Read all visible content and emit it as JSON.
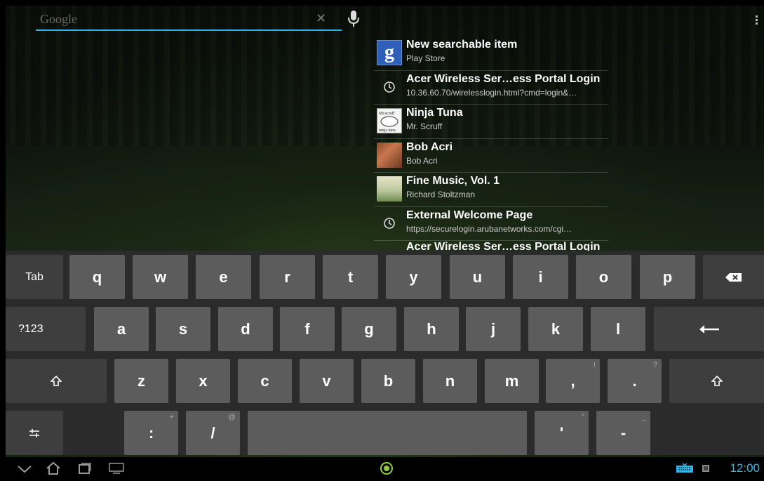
{
  "search": {
    "placeholder": "Google"
  },
  "suggestions": [
    {
      "title": "New searchable item",
      "subtitle": "Play Store",
      "icon": "google-g-icon"
    },
    {
      "title": "Acer Wireless Ser…ess Portal Login",
      "subtitle": "10.36.60.70/wirelesslogin.html?cmd=login&…",
      "icon": "history-clock-icon"
    },
    {
      "title": "Ninja Tuna",
      "subtitle": "Mr. Scruff",
      "icon": "album-art-icon"
    },
    {
      "title": "Bob Acri",
      "subtitle": "Bob Acri",
      "icon": "album-art-icon"
    },
    {
      "title": "Fine Music, Vol. 1",
      "subtitle": "Richard Stoltzman",
      "icon": "album-art-icon"
    },
    {
      "title": "External Welcome Page",
      "subtitle": "https://securelogin.arubanetworks.com/cgi…",
      "icon": "history-clock-icon"
    },
    {
      "title": "Acer Wireless Ser…ess Portal Login"
    }
  ],
  "keyboard": {
    "tab": "Tab",
    "row1": [
      "q",
      "w",
      "e",
      "r",
      "t",
      "y",
      "u",
      "i",
      "o",
      "p"
    ],
    "sym": "?123",
    "row2": [
      "a",
      "s",
      "d",
      "f",
      "g",
      "h",
      "j",
      "k",
      "l"
    ],
    "row3": [
      "z",
      "x",
      "c",
      "v",
      "b",
      "n",
      "m",
      ",",
      "."
    ],
    "row3_hints": [
      "",
      "",
      "",
      "",
      "",
      "",
      "",
      "!",
      "?"
    ],
    "row4": [
      ":",
      "/",
      "'",
      "-"
    ],
    "row4_hints": [
      "+",
      "@",
      "\"",
      "_"
    ]
  },
  "status": {
    "time": "12:00"
  },
  "colors": {
    "accent": "#33b5e5",
    "key": "#5c5c5c",
    "key_dark": "#3e3e3e",
    "keyboard_bg": "#2b2b2b"
  }
}
